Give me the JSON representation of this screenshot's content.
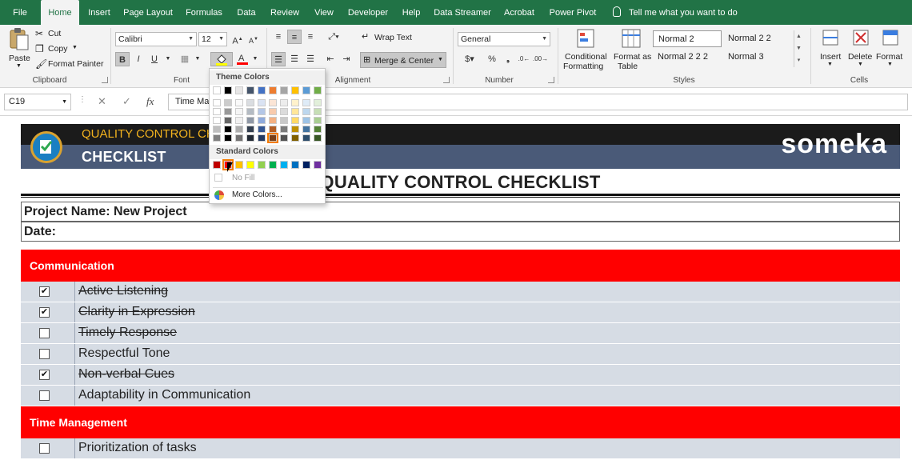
{
  "tabs": [
    "File",
    "Home",
    "Insert",
    "Page Layout",
    "Formulas",
    "Data",
    "Review",
    "View",
    "Developer",
    "Help",
    "Data Streamer",
    "Acrobat",
    "Power Pivot"
  ],
  "tell_me": "Tell me what you want to do",
  "ribbon": {
    "clipboard": {
      "paste": "Paste",
      "cut": "Cut",
      "copy": "Copy",
      "format_painter": "Format Painter",
      "label": "Clipboard"
    },
    "font": {
      "name": "Calibri",
      "size": "12",
      "bold": "B",
      "italic": "I",
      "underline": "U",
      "label": "Font"
    },
    "alignment": {
      "wrap_text": "Wrap Text",
      "merge_center": "Merge & Center",
      "label": "Alignment"
    },
    "number": {
      "format": "General",
      "label": "Number"
    },
    "styles": {
      "conditional": "Conditional",
      "conditional2": "Formatting",
      "format_as": "Format as",
      "format_as2": "Table",
      "normal2": "Normal 2",
      "normal22": "Normal 2 2",
      "normal222": "Normal 2 2 2",
      "normal3": "Normal 3",
      "label": "Styles"
    },
    "cells": {
      "insert": "Insert",
      "delete": "Delete",
      "format": "Format",
      "label": "Cells"
    }
  },
  "formula_bar": {
    "name_box": "C19",
    "content": "Time Ma"
  },
  "banner": {
    "title": "QUALITY CONTROL CH",
    "subtitle": "CHECKLIST",
    "brand": "someka"
  },
  "sheet": {
    "title": "QUALITY CONTROL CHECKLIST",
    "project": "Project Name: New Project",
    "date": "Date:",
    "sections": [
      {
        "name": "Communication",
        "items": [
          {
            "text": "Active Listening",
            "checked": true
          },
          {
            "text": "Clarity in Expression",
            "checked": true
          },
          {
            "text": "Timely Response",
            "checked": false
          },
          {
            "text": "Respectful Tone",
            "checked": false
          },
          {
            "text": "Non-verbal Cues",
            "checked": true
          },
          {
            "text": "Adaptability in Communication",
            "checked": false
          }
        ]
      },
      {
        "name": "Time Management",
        "items": [
          {
            "text": "Prioritization of tasks",
            "checked": false
          }
        ]
      }
    ]
  },
  "color_menu": {
    "theme_label": "Theme Colors",
    "standard_label": "Standard Colors",
    "no_fill": "No Fill",
    "more_colors": "More Colors...",
    "theme_top": [
      "#ffffff",
      "#000000",
      "#e7e6e6",
      "#44546a",
      "#4472c4",
      "#ed7d31",
      "#a5a5a5",
      "#ffc000",
      "#5b9bd5",
      "#70ad47"
    ],
    "standard": [
      "#c00000",
      "#ff0000",
      "#ffc000",
      "#ffff00",
      "#92d050",
      "#00b050",
      "#00b0f0",
      "#0070c0",
      "#002060",
      "#7030a0"
    ]
  },
  "colors": {
    "ribbon_green": "#217346",
    "section_red": "#ff0000",
    "row_fill": "#d6dce4"
  }
}
